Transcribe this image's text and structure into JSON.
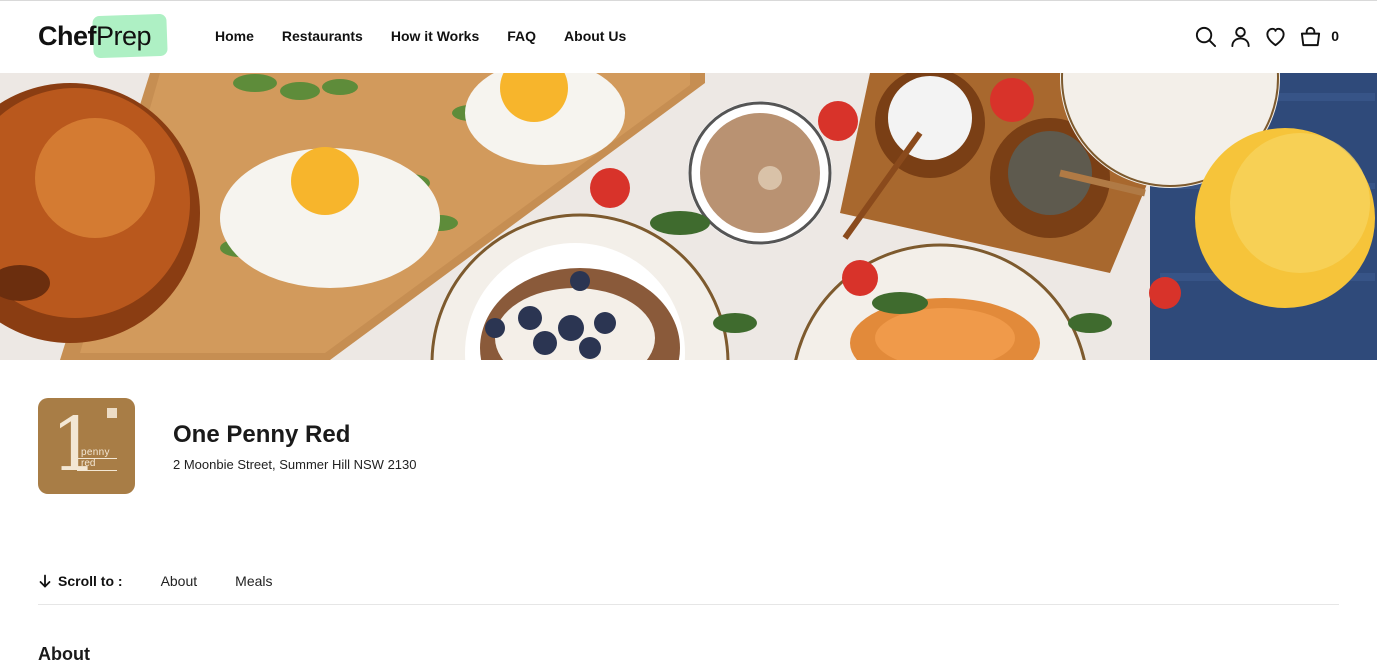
{
  "header": {
    "logo": {
      "part1": "Chef",
      "part2": "Prep"
    },
    "nav": [
      {
        "label": "Home"
      },
      {
        "label": "Restaurants"
      },
      {
        "label": "How it Works"
      },
      {
        "label": "FAQ"
      },
      {
        "label": "About Us"
      }
    ],
    "icons": [
      "search-icon",
      "user-icon",
      "heart-icon",
      "cart-icon"
    ],
    "cart_count": "0"
  },
  "hero": {
    "description": "banner-image"
  },
  "restaurant": {
    "name": "One Penny Red",
    "address": "2 Moonbie Street, Summer Hill NSW 2130",
    "logo": {
      "number": "1",
      "line1": "penny",
      "line2": "red",
      "bg_color": "#a87d46"
    }
  },
  "scroll_to": {
    "label": "Scroll to :",
    "links": [
      {
        "label": "About"
      },
      {
        "label": "Meals"
      }
    ]
  },
  "sections": {
    "about_title": "About"
  },
  "colors": {
    "logo_highlight": "#aef0c4",
    "text": "#111111",
    "divider": "#e6e6e6"
  }
}
